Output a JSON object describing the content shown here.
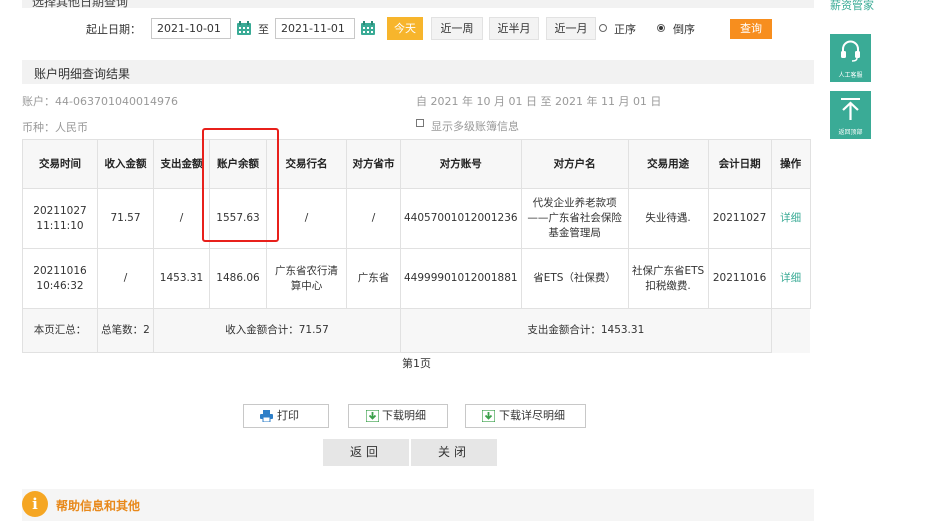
{
  "top_cut_title": "选择其他日期查询",
  "date_query": {
    "label": "起止日期：",
    "start": "2021-10-01",
    "to": "至",
    "end": "2021-11-01",
    "buttons": [
      "今天",
      "近一周",
      "近半月",
      "近一月"
    ],
    "order_asc": "正序",
    "order_desc": "倒序",
    "selected_order": "倒序",
    "query": "查询"
  },
  "result_title": "账户明细查询结果",
  "account_label": "账户：44-063701040014976",
  "date_range_text": "自 2021 年 10 月 01 日 至 2021 年 11 月 01 日",
  "currency_label": "币种：人民币",
  "show_multilevel": "显示多级账簿信息",
  "table": {
    "headers": [
      "交易时间",
      "收入金额",
      "支出金额",
      "账户余额",
      "交易行名",
      "对方省市",
      "对方账号",
      "对方户名",
      "交易用途",
      "会计日期",
      "操作"
    ],
    "rows": [
      {
        "time": "20211027 11:11:10",
        "income": "71.57",
        "expense": "/",
        "balance": "1557.63",
        "bank": "/",
        "province": "/",
        "account": "44057001012001236",
        "name": "代发企业养老款项——广东省社会保险基金管理局",
        "purpose": "失业待遇.",
        "date": "20211027",
        "op": "详细"
      },
      {
        "time": "20211016 10:46:32",
        "income": "/",
        "expense": "1453.31",
        "balance": "1486.06",
        "bank": "广东省农行清算中心",
        "province": "广东省",
        "account": "44999901012001881",
        "name": "省ETS（社保费）",
        "purpose": "社保广东省ETS扣税缴费.",
        "date": "20211016",
        "op": "详细"
      }
    ],
    "summary": {
      "label": "本页汇总：",
      "count": "总笔数：2",
      "income_total": "收入金额合计：71.57",
      "expense_total": "支出金额合计：1453.31"
    }
  },
  "page_indicator": "第1页",
  "actions": {
    "print": "打印",
    "download": "下载明细",
    "download_full": "下载详尽明细"
  },
  "nav": {
    "back": "返回",
    "close": "关闭"
  },
  "help_title": "帮助信息和其他",
  "sidebar": {
    "label": "薪资管家",
    "service": "人工客服",
    "top": "返回顶部"
  },
  "colors": {
    "accent_green": "#3aab96",
    "today_yellow": "#f7b52c",
    "query_orange": "#f78e1e",
    "highlight_red": "#e8201b"
  }
}
